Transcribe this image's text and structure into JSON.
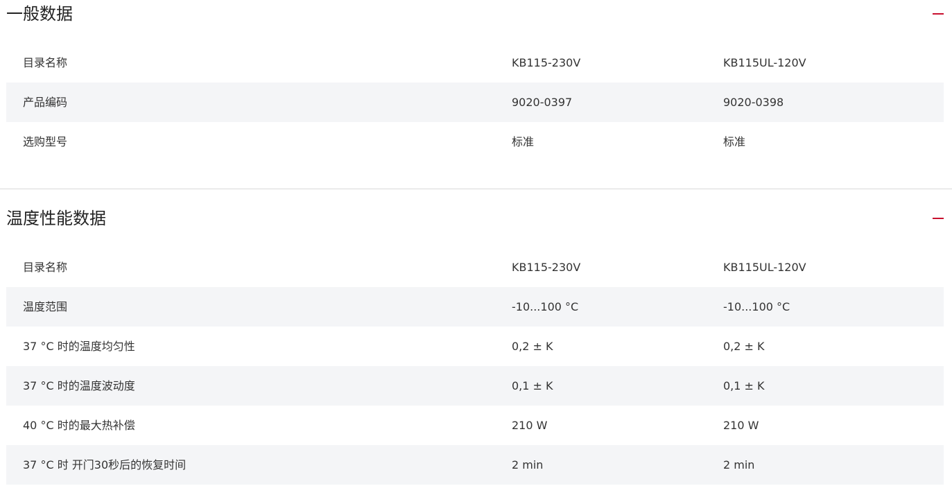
{
  "sections": [
    {
      "title": "一般数据",
      "rows": [
        {
          "label": "目录名称",
          "v1": "KB115-230V",
          "v2": "KB115UL-120V"
        },
        {
          "label": "产品编码",
          "v1": "9020-0397",
          "v2": "9020-0398"
        },
        {
          "label": "选购型号",
          "v1": "标准",
          "v2": "标准"
        }
      ]
    },
    {
      "title": "温度性能数据",
      "rows": [
        {
          "label": "目录名称",
          "v1": "KB115-230V",
          "v2": "KB115UL-120V"
        },
        {
          "label": "温度范围",
          "v1": "-10...100 °C",
          "v2": "-10...100 °C"
        },
        {
          "label": "37 °C 时的温度均匀性",
          "v1": "0,2 ± K",
          "v2": "0,2 ± K"
        },
        {
          "label": "37 °C 时的温度波动度",
          "v1": "0,1 ± K",
          "v2": "0,1 ± K"
        },
        {
          "label": "40 °C 时的最大热补偿",
          "v1": "210 W",
          "v2": "210 W"
        },
        {
          "label": "37 °C 时 开门30秒后的恢复时间",
          "v1": "2 min",
          "v2": "2 min"
        }
      ]
    }
  ],
  "icons": {
    "collapse": "minus-icon"
  },
  "colors": {
    "accent": "#c8102e",
    "row_alt": "#f4f5f7",
    "divider": "#d9d9d9"
  }
}
